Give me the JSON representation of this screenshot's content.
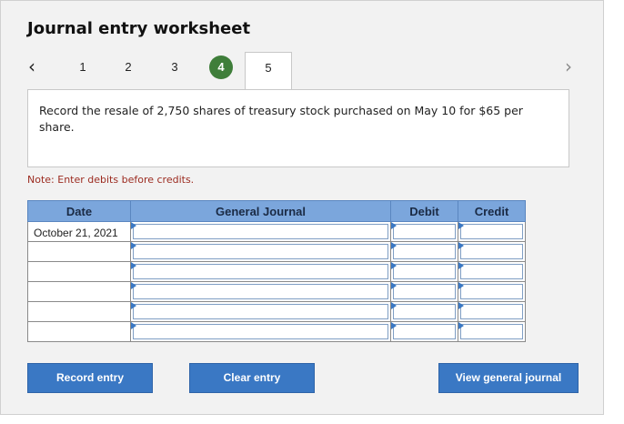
{
  "title": "Journal entry worksheet",
  "nav": {
    "prev_icon": "chevron-left-icon",
    "next_icon": "chevron-right-icon",
    "steps": [
      {
        "label": "1"
      },
      {
        "label": "2"
      },
      {
        "label": "3"
      },
      {
        "label": "4"
      },
      {
        "label": "5"
      }
    ],
    "active_step_color": "#3f7e3a"
  },
  "instruction": "Record the resale of 2,750 shares of treasury stock purchased on May 10 for $65 per share.",
  "note": "Note: Enter debits before credits.",
  "table": {
    "headers": {
      "date": "Date",
      "account": "General Journal",
      "debit": "Debit",
      "credit": "Credit"
    },
    "rows": [
      {
        "date": "October 21, 2021",
        "account": "",
        "debit": "",
        "credit": ""
      },
      {
        "date": "",
        "account": "",
        "debit": "",
        "credit": ""
      },
      {
        "date": "",
        "account": "",
        "debit": "",
        "credit": ""
      },
      {
        "date": "",
        "account": "",
        "debit": "",
        "credit": ""
      },
      {
        "date": "",
        "account": "",
        "debit": "",
        "credit": ""
      },
      {
        "date": "",
        "account": "",
        "debit": "",
        "credit": ""
      }
    ]
  },
  "buttons": {
    "record": "Record entry",
    "clear": "Clear entry",
    "view": "View general journal"
  },
  "colors": {
    "header_blue": "#7ba6dc",
    "button_blue": "#3a78c4",
    "note_red": "#9c2b20"
  }
}
